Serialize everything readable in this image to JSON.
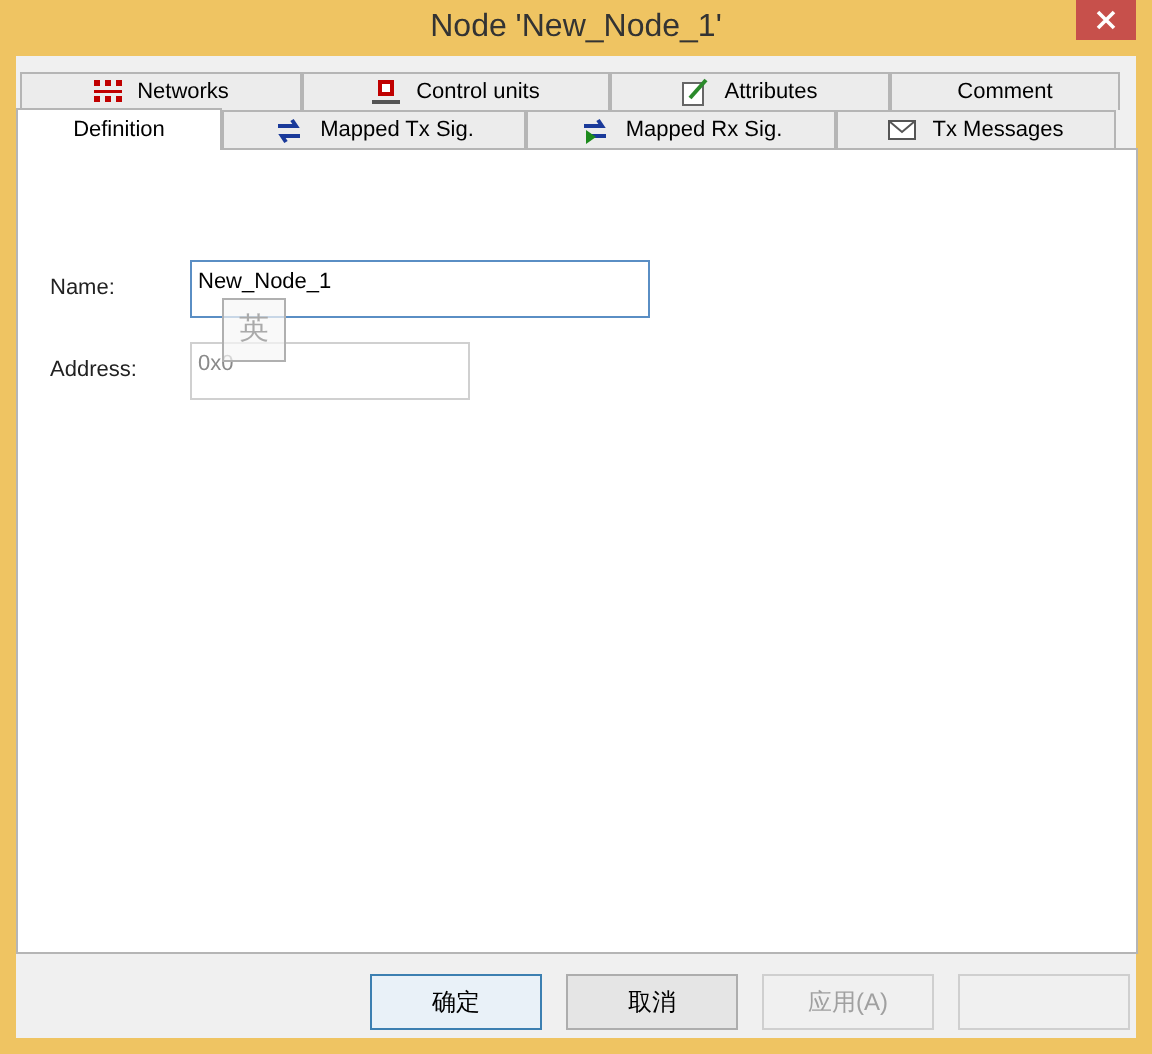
{
  "window": {
    "title": "Node 'New_Node_1'"
  },
  "tab_rows": [
    {
      "tabs": [
        {
          "label": "Networks",
          "selected": false
        },
        {
          "label": "Control units",
          "selected": false
        },
        {
          "label": "Attributes",
          "selected": false
        },
        {
          "label": "Comment",
          "selected": false
        }
      ]
    },
    {
      "tabs": [
        {
          "label": "Definition",
          "selected": true
        },
        {
          "label": "Mapped Tx Sig.",
          "selected": false
        },
        {
          "label": "Mapped Rx Sig.",
          "selected": false
        },
        {
          "label": "Tx Messages",
          "selected": false
        }
      ]
    }
  ],
  "fields": [
    {
      "label": "Name:",
      "value": "New_Node_1",
      "disabled": false,
      "focused": true
    },
    {
      "label": "Address:",
      "value": "0x0",
      "disabled": true,
      "focused": false
    }
  ],
  "ime_indicator": "英",
  "buttons": [
    {
      "label": "确定",
      "default": true,
      "disabled": false
    },
    {
      "label": "取消",
      "default": false,
      "disabled": false
    },
    {
      "label": "应用(A)",
      "default": false,
      "disabled": true
    },
    {
      "default": false,
      "disabled": true
    }
  ]
}
